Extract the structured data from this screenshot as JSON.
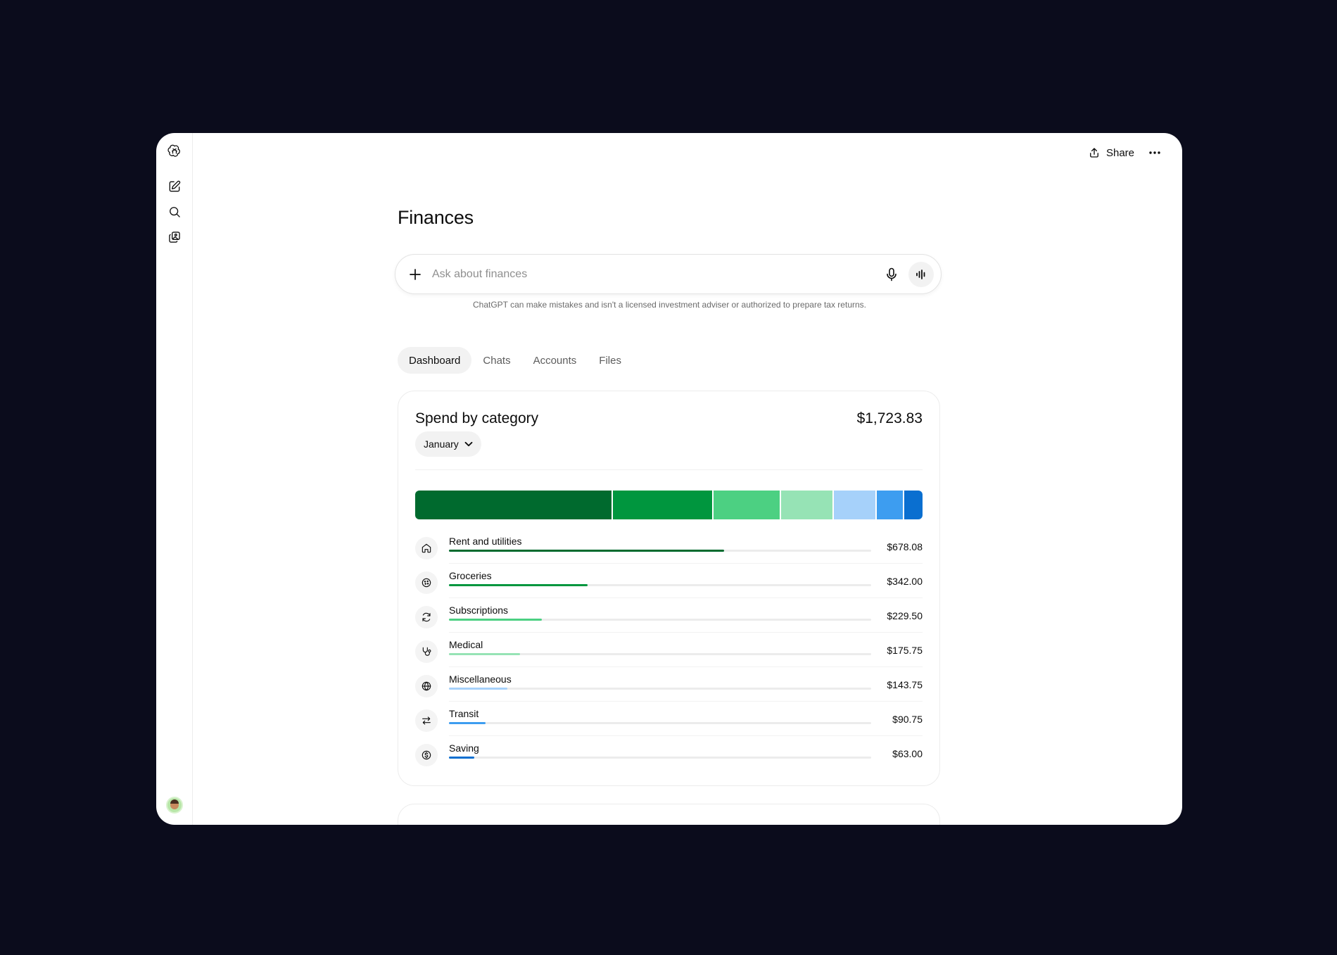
{
  "topbar": {
    "share_label": "Share"
  },
  "page": {
    "title": "Finances"
  },
  "composer": {
    "placeholder": "Ask about finances",
    "disclaimer": "ChatGPT can make mistakes and isn't a licensed investment adviser or authorized to prepare tax returns."
  },
  "tabs": [
    {
      "label": "Dashboard",
      "active": true
    },
    {
      "label": "Chats",
      "active": false
    },
    {
      "label": "Accounts",
      "active": false
    },
    {
      "label": "Files",
      "active": false
    }
  ],
  "spend": {
    "title": "Spend by category",
    "total": "$1,723.83",
    "month": "January",
    "categories": [
      {
        "name": "Rent and utilities",
        "amount": "$678.08",
        "value": 678.08,
        "color": "#006a2e",
        "icon": "home-icon"
      },
      {
        "name": "Groceries",
        "amount": "$342.00",
        "value": 342.0,
        "color": "#00963e",
        "icon": "cookie-icon"
      },
      {
        "name": "Subscriptions",
        "amount": "$229.50",
        "value": 229.5,
        "color": "#4cd082",
        "icon": "refresh-icon"
      },
      {
        "name": "Medical",
        "amount": "$175.75",
        "value": 175.75,
        "color": "#96e3b5",
        "icon": "stethoscope-icon"
      },
      {
        "name": "Miscellaneous",
        "amount": "$143.75",
        "value": 143.75,
        "color": "#a6d1fa",
        "icon": "globe-icon"
      },
      {
        "name": "Transit",
        "amount": "$90.75",
        "value": 90.75,
        "color": "#3d9df0",
        "icon": "transfer-icon"
      },
      {
        "name": "Saving",
        "amount": "$63.00",
        "value": 63.0,
        "color": "#0a6fd0",
        "icon": "dollar-icon"
      }
    ]
  }
}
